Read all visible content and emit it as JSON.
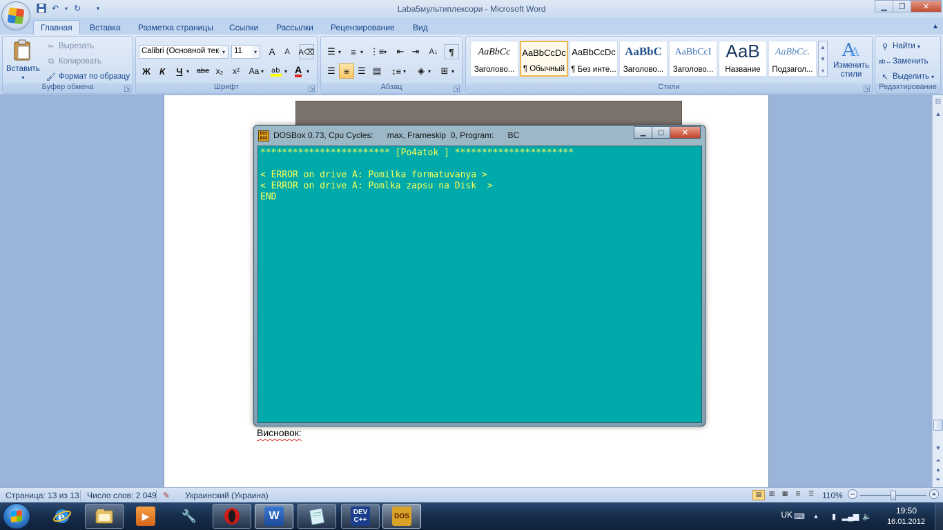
{
  "window": {
    "title": "Laba5мультиплексори - Microsoft Word",
    "minimize_icon": "minimize-icon",
    "maximize_icon": "maximize-icon",
    "close_icon": "close-icon"
  },
  "quick_access": {
    "save_icon": "save-icon",
    "undo_icon": "undo-icon",
    "redo_icon": "redo-icon",
    "customize_icon": "chevron-down-icon"
  },
  "tabs": [
    {
      "label": "Главная"
    },
    {
      "label": "Вставка"
    },
    {
      "label": "Разметка страницы"
    },
    {
      "label": "Ссылки"
    },
    {
      "label": "Рассылки"
    },
    {
      "label": "Рецензирование"
    },
    {
      "label": "Вид"
    }
  ],
  "clipboard": {
    "paste": "Вставить",
    "cut": "Вырезать",
    "copy": "Копировать",
    "format_painter": "Формат по образцу",
    "label": "Буфер обмена"
  },
  "font": {
    "name": "Calibri (Основной текс",
    "size": "11",
    "grow": "A",
    "shrink": "A",
    "bold": "Ж",
    "italic": "К",
    "underline": "Ч",
    "strike": "abe",
    "subscript": "x₂",
    "superscript": "x²",
    "change_case": "Aa",
    "font_color": "A",
    "label": "Шрифт"
  },
  "paragraph": {
    "show_marks": "¶",
    "label": "Абзац"
  },
  "styles": {
    "items": [
      {
        "sample": "AaBbCc",
        "name": "Заголово..."
      },
      {
        "sample": "AaBbCcDc",
        "name": "¶ Обычный"
      },
      {
        "sample": "AaBbCcDc",
        "name": "¶ Без инте..."
      },
      {
        "sample": "AaBbC",
        "name": "Заголово..."
      },
      {
        "sample": "AaBbCcI",
        "name": "Заголово..."
      },
      {
        "sample": "АаВ",
        "name": "Название"
      },
      {
        "sample": "AaBbCc.",
        "name": "Подзагол..."
      }
    ],
    "change_styles": "Изменить стили",
    "label": "Стили"
  },
  "editing": {
    "find": "Найти",
    "replace": "Заменить",
    "select": "Выделить",
    "label": "Редактирование"
  },
  "document": {
    "conclusion": "Висновок:"
  },
  "dosbox": {
    "title": "DOSBox 0.73, Cpu Cycles:      max, Frameskip  0, Program:      BC",
    "icon_text": "DOS BOX",
    "lines": [
      "************************ [Po4atok ] **********************",
      "",
      "< ERROR on drive A: Pomilka formatuvanya >",
      "< ERROR on drive A: Pomlka zapsu na Disk  >",
      "END"
    ],
    "colors": {
      "background": "#00aaaa",
      "text": "#ffff55"
    }
  },
  "status": {
    "page": "Страница: 13 из 13",
    "words": "Число слов: 2 049",
    "language": "Украинский (Украина)",
    "zoom": "110%",
    "zoom_out": "−",
    "zoom_in": "+"
  },
  "taskbar": {
    "apps": [
      {
        "name": "internet-explorer-icon"
      },
      {
        "name": "file-explorer-icon"
      },
      {
        "name": "media-player-icon"
      },
      {
        "name": "tools-icon"
      },
      {
        "name": "opera-icon"
      },
      {
        "name": "word-icon"
      },
      {
        "name": "notepad-icon"
      },
      {
        "name": "dev-cpp-icon",
        "text": "DEV C++"
      },
      {
        "name": "dosbox-icon",
        "text": "DOS"
      }
    ],
    "language": "UK",
    "time": "19:50",
    "date": "16.01.2012"
  }
}
